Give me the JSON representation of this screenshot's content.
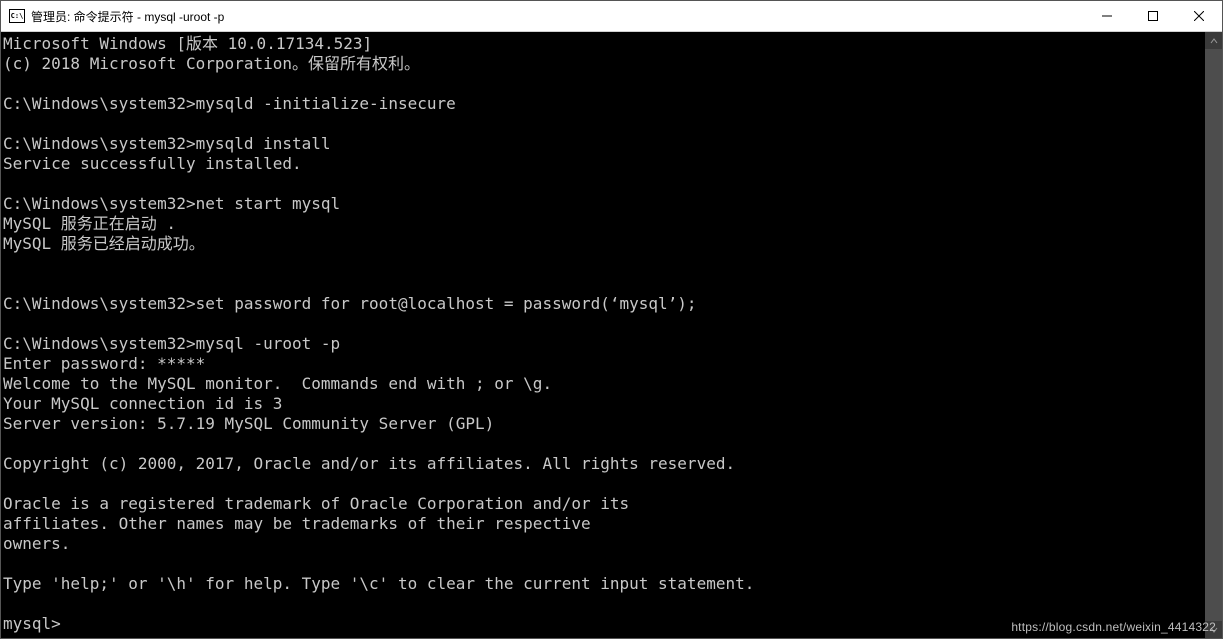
{
  "titlebar": {
    "icon_text": "C:\\",
    "title": "管理员: 命令提示符 - mysql  -uroot -p"
  },
  "terminal": {
    "lines": [
      "Microsoft Windows [版本 10.0.17134.523]",
      "(c) 2018 Microsoft Corporation。保留所有权利。",
      "",
      "C:\\Windows\\system32>mysqld -initialize-insecure",
      "",
      "C:\\Windows\\system32>mysqld install",
      "Service successfully installed.",
      "",
      "C:\\Windows\\system32>net start mysql",
      "MySQL 服务正在启动 .",
      "MySQL 服务已经启动成功。",
      "",
      "",
      "C:\\Windows\\system32>set password for root@localhost = password(‘mysql’);",
      "",
      "C:\\Windows\\system32>mysql -uroot -p",
      "Enter password: *****",
      "Welcome to the MySQL monitor.  Commands end with ; or \\g.",
      "Your MySQL connection id is 3",
      "Server version: 5.7.19 MySQL Community Server (GPL)",
      "",
      "Copyright (c) 2000, 2017, Oracle and/or its affiliates. All rights reserved.",
      "",
      "Oracle is a registered trademark of Oracle Corporation and/or its",
      "affiliates. Other names may be trademarks of their respective",
      "owners.",
      "",
      "Type 'help;' or '\\h' for help. Type '\\c' to clear the current input statement.",
      "",
      "mysql>"
    ]
  },
  "watermark": "https://blog.csdn.net/weixin_4414322"
}
